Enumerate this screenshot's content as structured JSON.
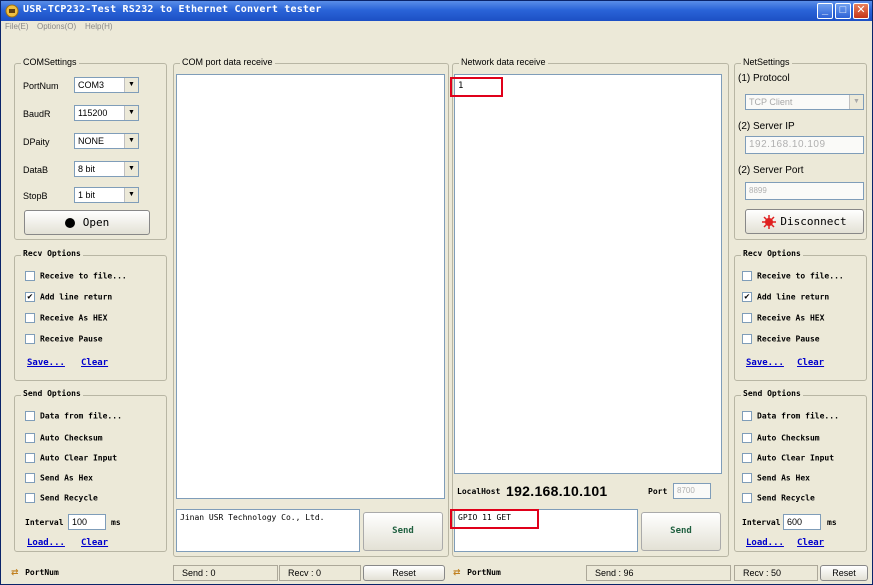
{
  "window": {
    "title": "USR-TCP232-Test   RS232 to Ethernet Convert tester",
    "menu": [
      "File(E)",
      "Options(O)",
      "Help(H)"
    ]
  },
  "com_settings": {
    "title": "COMSettings",
    "fields": [
      {
        "label": "PortNum",
        "value": "COM3"
      },
      {
        "label": "BaudR",
        "value": "115200"
      },
      {
        "label": "DPaity",
        "value": "NONE"
      },
      {
        "label": "DataB",
        "value": "8 bit"
      },
      {
        "label": "StopB",
        "value": "1 bit"
      }
    ],
    "open_button": "Open"
  },
  "recv_options_left": {
    "title": "Recv Options",
    "options": [
      {
        "label": "Receive to file...",
        "checked": false
      },
      {
        "label": "Add line return",
        "checked": true
      },
      {
        "label": "Receive As HEX",
        "checked": false
      },
      {
        "label": "Receive Pause",
        "checked": false
      }
    ],
    "save": "Save...",
    "clear": "Clear"
  },
  "send_options_left": {
    "title": "Send Options",
    "options": [
      {
        "label": "Data from file...",
        "checked": false
      },
      {
        "label": "Auto Checksum",
        "checked": false
      },
      {
        "label": "Auto Clear Input",
        "checked": false
      },
      {
        "label": "Send As Hex",
        "checked": false
      },
      {
        "label": "Send Recycle",
        "checked": false
      }
    ],
    "interval_label": "Interval",
    "interval_value": "100",
    "interval_unit": "ms",
    "load": "Load...",
    "clear": "Clear"
  },
  "com_panel": {
    "title": "COM port data receive",
    "send_text": "Jinan USR Technology Co., Ltd.",
    "send_button": "Send"
  },
  "net_panel": {
    "title": "Network data receive",
    "received_text": "1",
    "localhost_label": "LocalHost",
    "localhost_value": "192.168.10.101",
    "port_label": "Port",
    "port_value": "8700",
    "send_text": "GPIO 11 GET",
    "send_button": "Send"
  },
  "net_settings": {
    "title": "NetSettings",
    "protocol_label": "(1) Protocol",
    "protocol_value": "TCP Client",
    "server_ip_label": "(2) Server IP",
    "server_ip_value": "192.168.10.109",
    "server_port_label": "(2) Server Port",
    "server_port_value": "8899",
    "disconnect_button": "Disconnect"
  },
  "recv_options_right": {
    "title": "Recv Options",
    "options": [
      {
        "label": "Receive to file...",
        "checked": false
      },
      {
        "label": "Add line return",
        "checked": true
      },
      {
        "label": "Receive As HEX",
        "checked": false
      },
      {
        "label": "Receive Pause",
        "checked": false
      }
    ],
    "save": "Save...",
    "clear": "Clear"
  },
  "send_options_right": {
    "title": "Send Options",
    "options": [
      {
        "label": "Data from file...",
        "checked": false
      },
      {
        "label": "Auto Checksum",
        "checked": false
      },
      {
        "label": "Auto Clear Input",
        "checked": false
      },
      {
        "label": "Send As Hex",
        "checked": false
      },
      {
        "label": "Send Recycle",
        "checked": false
      }
    ],
    "interval_label": "Interval",
    "interval_value": "600",
    "interval_unit": "ms",
    "load": "Load...",
    "clear": "Clear"
  },
  "status_left": {
    "portnum": "PortNum",
    "send": "Send : 0",
    "recv": "Recv : 0",
    "reset": "Reset"
  },
  "status_right": {
    "portnum": "PortNum",
    "send": "Send : 96",
    "recv": "Recv : 50",
    "reset": "Reset"
  },
  "colors": {
    "titlebar": "#2a64d8",
    "highlight": "#e0001a",
    "link": "#0000cc"
  }
}
